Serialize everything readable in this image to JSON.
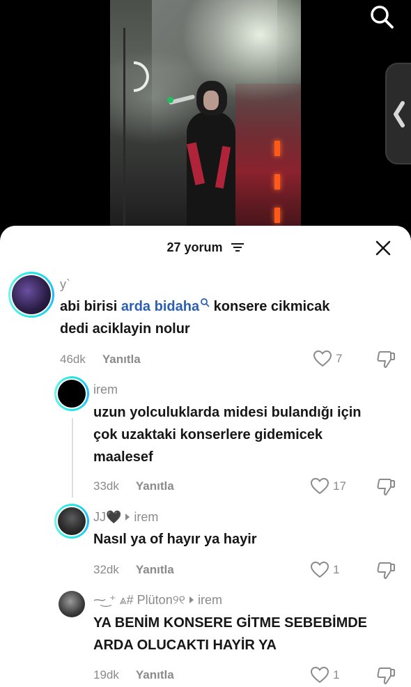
{
  "video": {
    "search_icon": "search-icon",
    "side_tab_icon": "chevron-left-icon"
  },
  "sheet": {
    "count_label": "27 yorum",
    "sort_icon": "sort-icon",
    "close_icon": "close-icon"
  },
  "comments": [
    {
      "username": "y`",
      "text_before": "abi birisi ",
      "mention": "arda bidaha",
      "text_after_line1": " konsere cikmicak",
      "text_line2": "dedi aciklayin nolur",
      "time": "46dk",
      "reply_label": "Yanıtla",
      "likes": "7"
    },
    {
      "username": "irem",
      "text_lines": [
        "uzun yolculuklarda midesi bulandığı için",
        "çok uzaktaki konserlere gidemicek",
        "maalesef"
      ],
      "time": "33dk",
      "reply_label": "Yanıtla",
      "likes": "17"
    },
    {
      "username": "JJ🖤",
      "reply_to": "irem",
      "text_lines": [
        "Nasıl ya of hayır ya hayir"
      ],
      "time": "32dk",
      "reply_label": "Yanıtla",
      "likes": "1"
    },
    {
      "username": "⁓͜ ⁺ ⩓# Plüton୨୧",
      "reply_to": "irem",
      "text_lines": [
        "YA BENİM KONSERE GİTME SEBEBİMDE",
        "ARDA OLUCAKTI HAYİR YA"
      ],
      "time": "19dk",
      "reply_label": "Yanıtla",
      "likes": "1"
    }
  ],
  "colors": {
    "accent_ring": "#25e8e0",
    "mention": "#2b5fb3",
    "muted": "#8a8a8a",
    "text": "#161616"
  }
}
